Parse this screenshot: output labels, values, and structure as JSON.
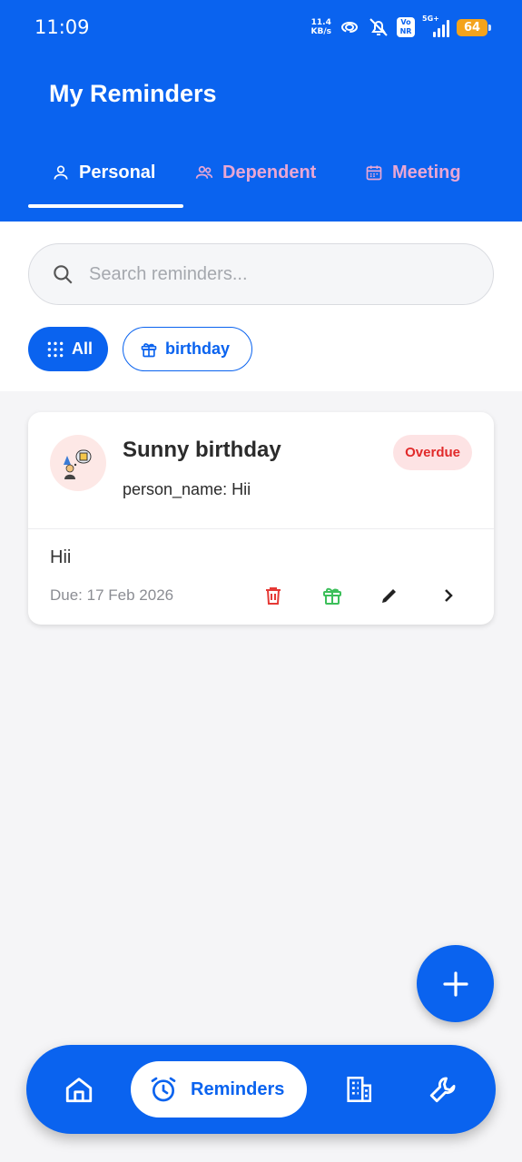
{
  "status_bar": {
    "time": "11:09",
    "net_speed_value": "11.4",
    "net_speed_unit": "KB/s",
    "volte_top": "Vo",
    "volte_bottom": "NR",
    "network_type": "5G+",
    "battery": "64"
  },
  "header": {
    "title": "My Reminders",
    "tabs": [
      {
        "label": "Personal",
        "icon": "person-icon",
        "active": true
      },
      {
        "label": "Dependent",
        "icon": "people-icon",
        "active": false
      },
      {
        "label": "Meeting",
        "icon": "calendar-icon",
        "active": false
      }
    ]
  },
  "search": {
    "placeholder": "Search reminders...",
    "value": ""
  },
  "filters": [
    {
      "label": "All",
      "icon": "grid-icon",
      "selected": true
    },
    {
      "label": "birthday",
      "icon": "gift-icon",
      "selected": false
    }
  ],
  "reminders": [
    {
      "title": "Sunny birthday",
      "subtitle": "person_name: Hii",
      "status": "Overdue",
      "note": "Hii",
      "due": "Due: 17 Feb 2026",
      "actions": [
        "trash-icon",
        "gift-icon",
        "edit-icon",
        "chevron-right-icon"
      ]
    }
  ],
  "bottom_nav": {
    "items": [
      {
        "name": "home-icon"
      },
      {
        "name": "alarm-clock-icon",
        "label": "Reminders",
        "active": true
      },
      {
        "name": "building-icon"
      },
      {
        "name": "wrench-icon"
      }
    ]
  },
  "colors": {
    "primary": "#0a63ef",
    "inactive_tab": "#e9a7d4",
    "overdue_text": "#e12a2a",
    "overdue_bg": "#fde3e4",
    "delete": "#e53935",
    "gift_action": "#3cbf5a"
  }
}
